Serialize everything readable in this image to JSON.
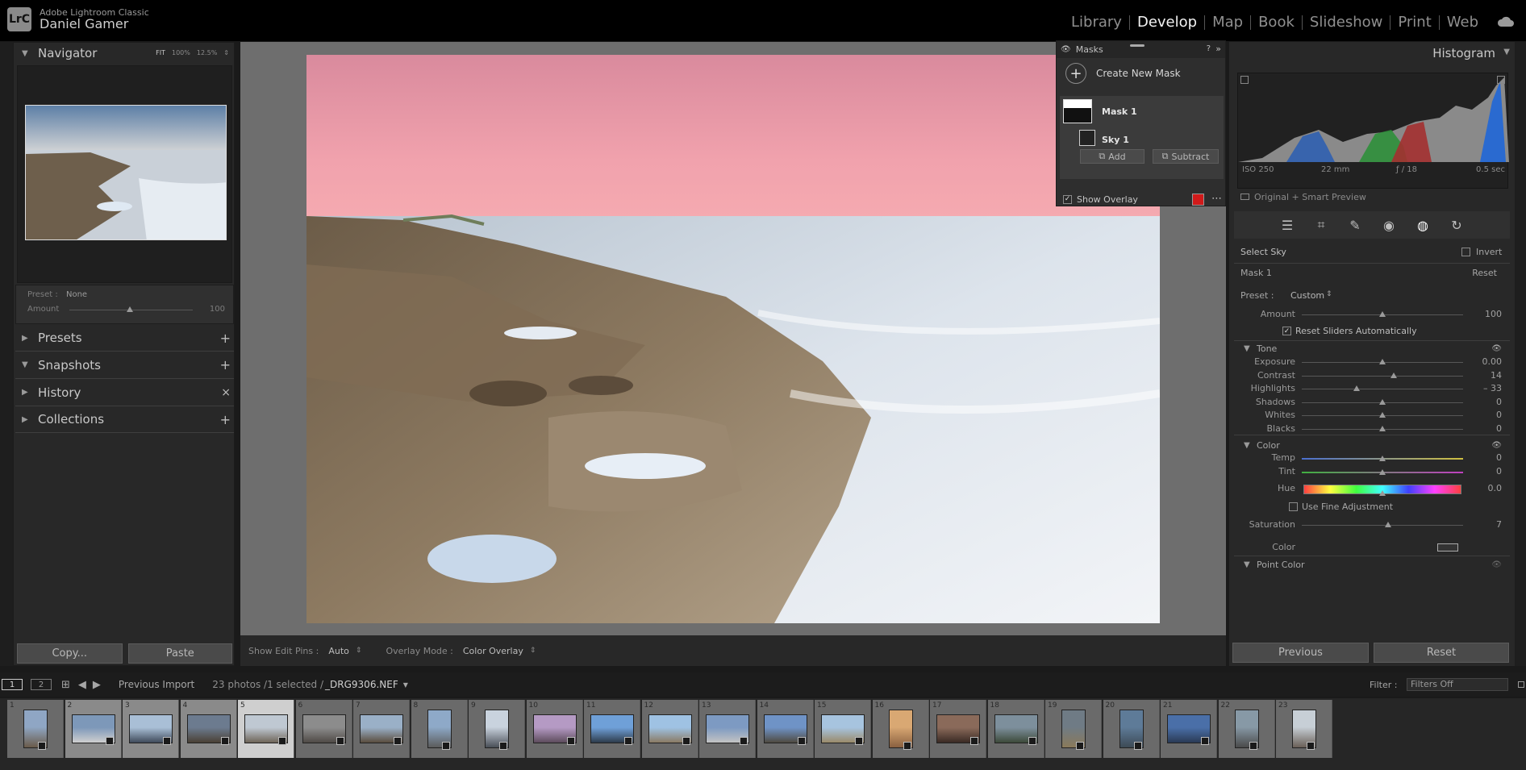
{
  "identity": {
    "logo": "LrC",
    "app_name": "Adobe Lightroom Classic",
    "user": "Daniel Gamer"
  },
  "modules": [
    {
      "label": "Library",
      "active": false
    },
    {
      "label": "Develop",
      "active": true
    },
    {
      "label": "Map",
      "active": false
    },
    {
      "label": "Book",
      "active": false
    },
    {
      "label": "Slideshow",
      "active": false
    },
    {
      "label": "Print",
      "active": false
    },
    {
      "label": "Web",
      "active": false
    }
  ],
  "navigator": {
    "title": "Navigator",
    "zoom_fit": "FIT",
    "zoom_100": "100%",
    "zoom_125": "12.5%"
  },
  "preset_box": {
    "preset_label": "Preset :",
    "preset_value": "None",
    "amount_label": "Amount",
    "amount_value": "100",
    "amount_level": 0.5
  },
  "left_sections": [
    {
      "label": "Presets",
      "action": "+"
    },
    {
      "label": "Snapshots",
      "action": "+"
    },
    {
      "label": "History",
      "action": "×"
    },
    {
      "label": "Collections",
      "action": "+"
    }
  ],
  "left_buttons": {
    "copy": "Copy...",
    "paste": "Paste"
  },
  "masks": {
    "title": "Masks",
    "create": "Create New Mask",
    "mask1": "Mask 1",
    "sky1": "Sky 1",
    "add": "Add",
    "subtract": "Subtract",
    "show_overlay": "Show Overlay",
    "overlay_color": "#d11a1a"
  },
  "histogram": {
    "title": "Histogram",
    "iso": "ISO 250",
    "focal": "22 mm",
    "aperture": "ƒ / 18",
    "shutter": "0.5 sec",
    "preview": "Original + Smart Preview"
  },
  "mask_panel": {
    "select": "Select Sky",
    "invert": "Invert",
    "mask_name": "Mask 1",
    "reset": "Reset",
    "preset_label": "Preset :",
    "preset_value": "Custom",
    "amount_label": "Amount",
    "amount_value": "100",
    "reset_sliders": "Reset Sliders Automatically",
    "tone_title": "Tone",
    "tone": [
      {
        "label": "Exposure",
        "value": "0.00",
        "pos": 0.5
      },
      {
        "label": "Contrast",
        "value": "14",
        "pos": 0.57
      },
      {
        "label": "Highlights",
        "value": "– 33",
        "pos": 0.34
      },
      {
        "label": "Shadows",
        "value": "0",
        "pos": 0.5
      },
      {
        "label": "Whites",
        "value": "0",
        "pos": 0.5
      },
      {
        "label": "Blacks",
        "value": "0",
        "pos": 0.5
      }
    ],
    "color_title": "Color",
    "color": [
      {
        "label": "Temp",
        "value": "0",
        "pos": 0.5
      },
      {
        "label": "Tint",
        "value": "0",
        "pos": 0.5
      }
    ],
    "hue_label": "Hue",
    "hue_value": "0.0",
    "fine_adjust": "Use Fine Adjustment",
    "saturation_label": "Saturation",
    "saturation_value": "7",
    "color_label": "Color",
    "point_color": "Point Color"
  },
  "right_buttons": {
    "previous": "Previous",
    "reset": "Reset"
  },
  "toolbar": {
    "pins_label": "Show Edit Pins :",
    "pins_value": "Auto",
    "overlay_label": "Overlay Mode :",
    "overlay_value": "Color Overlay"
  },
  "filmbar": {
    "view1": "1",
    "view2": "2",
    "source": "Previous Import",
    "count": "23 photos /1 selected /",
    "filename": "_DRG9306.NEF",
    "filter_label": "Filter :",
    "filter_value": "Filters Off"
  },
  "filmstrip": [
    {
      "n": "1",
      "portrait": true,
      "c": [
        "#8fa6c4",
        "#6a5a4a"
      ]
    },
    {
      "n": "2",
      "portrait": false,
      "c": [
        "#7d98b9",
        "#cfcfcf"
      ]
    },
    {
      "n": "3",
      "portrait": false,
      "c": [
        "#a9bfd6",
        "#3f4a5a"
      ]
    },
    {
      "n": "4",
      "portrait": false,
      "c": [
        "#6c7b8f",
        "#4a4035"
      ]
    },
    {
      "n": "5",
      "portrait": false,
      "c": [
        "#bfc8d2",
        "#6f6558"
      ]
    },
    {
      "n": "6",
      "portrait": false,
      "c": [
        "#8c8c8c",
        "#4f4a46"
      ]
    },
    {
      "n": "7",
      "portrait": false,
      "c": [
        "#9ab0c7",
        "#5a4d3e"
      ]
    },
    {
      "n": "8",
      "portrait": true,
      "c": [
        "#8ea9c8",
        "#5b5b5b"
      ]
    },
    {
      "n": "9",
      "portrait": true,
      "c": [
        "#c9d3de",
        "#4a4f57"
      ]
    },
    {
      "n": "10",
      "portrait": false,
      "c": [
        "#b59ac4",
        "#5d4c5c"
      ]
    },
    {
      "n": "11",
      "portrait": false,
      "c": [
        "#6fa0d8",
        "#2d3b4a"
      ]
    },
    {
      "n": "12",
      "portrait": false,
      "c": [
        "#9fc2e3",
        "#8a7a63"
      ]
    },
    {
      "n": "13",
      "portrait": false,
      "c": [
        "#7d9ac2",
        "#c3c3c3"
      ]
    },
    {
      "n": "14",
      "portrait": false,
      "c": [
        "#6f93c6",
        "#4f4a40"
      ]
    },
    {
      "n": "15",
      "portrait": false,
      "c": [
        "#a7c4df",
        "#9a8a6a"
      ]
    },
    {
      "n": "16",
      "portrait": true,
      "c": [
        "#d9a873",
        "#8a6040"
      ]
    },
    {
      "n": "17",
      "portrait": false,
      "c": [
        "#8a6a5a",
        "#3a2a24"
      ]
    },
    {
      "n": "18",
      "portrait": false,
      "c": [
        "#7d8f9c",
        "#3d4a3a"
      ]
    },
    {
      "n": "19",
      "portrait": true,
      "c": [
        "#6f7b85",
        "#8a7a5a"
      ]
    },
    {
      "n": "20",
      "portrait": true,
      "c": [
        "#5e7b98",
        "#3d4a55"
      ]
    },
    {
      "n": "21",
      "portrait": false,
      "c": [
        "#4a6fa8",
        "#2a3a55"
      ]
    },
    {
      "n": "22",
      "portrait": true,
      "c": [
        "#8799a6",
        "#4a4a4a"
      ]
    },
    {
      "n": "23",
      "portrait": true,
      "c": [
        "#c7cfd6",
        "#6a6058"
      ]
    }
  ]
}
